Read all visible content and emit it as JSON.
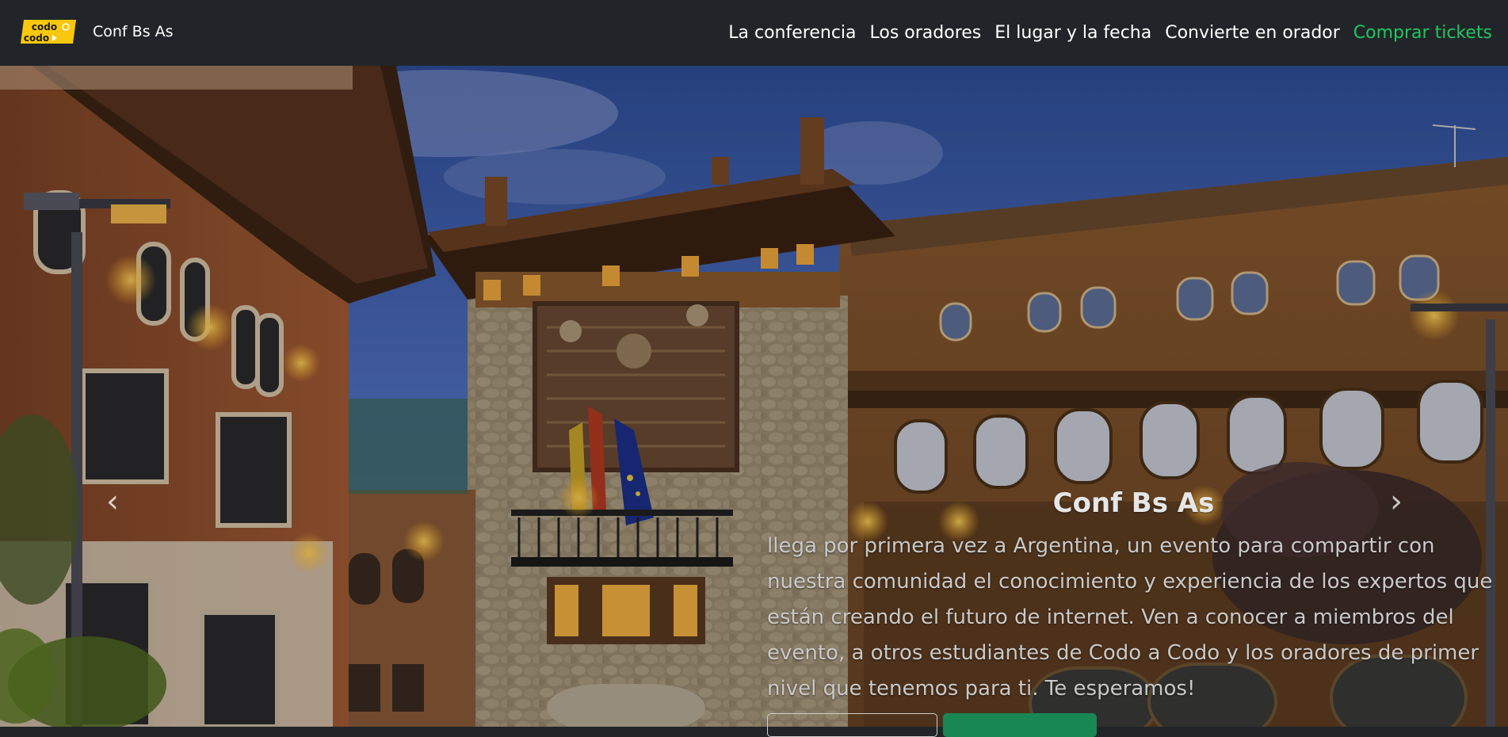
{
  "brand": {
    "logo_line1": "codo a",
    "logo_line2": "codo",
    "name": "Conf Bs As"
  },
  "nav": {
    "items": [
      {
        "label": "La conferencia"
      },
      {
        "label": "Los oradores"
      },
      {
        "label": "El lugar y la fecha"
      },
      {
        "label": "Convierte en orador"
      },
      {
        "label": "Comprar tickets"
      }
    ]
  },
  "hero": {
    "title": "Conf Bs As",
    "text": "llega por primera vez a Argentina, un evento para compartir con nuestra comunidad el conocimiento y experiencia de los expertos que están creando el futuro de internet. Ven a conocer a miembros del evento, a otros estudiantes de Codo a Codo y los oradores de primer nivel que tenemos para ti. Te esperamos!",
    "prev_icon": "chevron-left-icon",
    "next_icon": "chevron-right-icon"
  },
  "colors": {
    "navbar_bg": "#212529",
    "accent_green": "#1ec760",
    "logo_yellow": "#f9c80e",
    "button_green": "#198754"
  }
}
